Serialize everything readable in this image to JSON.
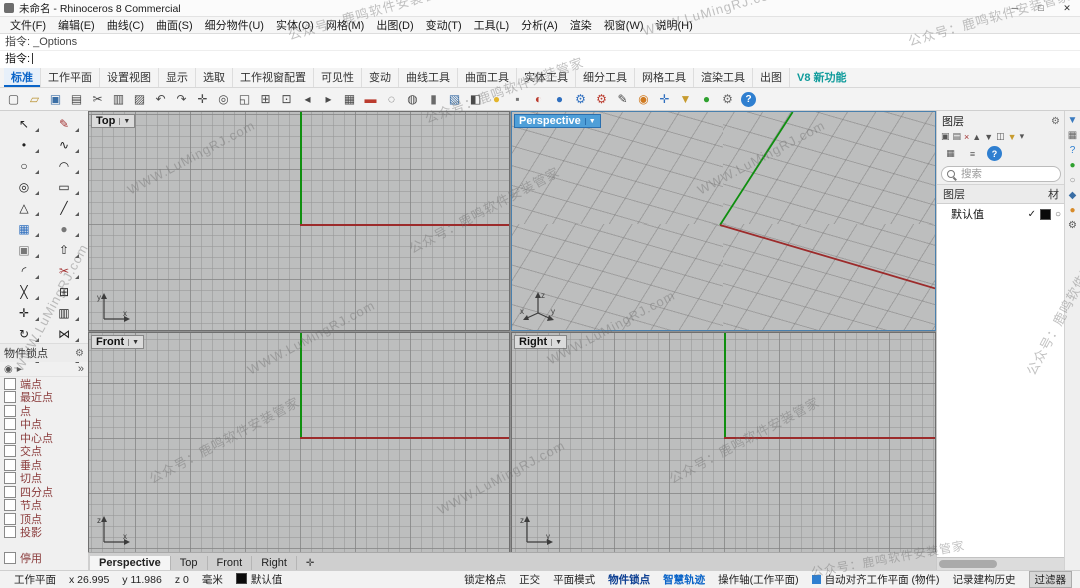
{
  "titlebar": {
    "title": "未命名 - Rhinoceros 8 Commercial",
    "minimize": "─",
    "maximize": "□",
    "close": "✕"
  },
  "menu": {
    "items": [
      "文件(F)",
      "编辑(E)",
      "曲线(C)",
      "曲面(S)",
      "细分物件(U)",
      "实体(O)",
      "网格(M)",
      "出图(D)",
      "变动(T)",
      "工具(L)",
      "分析(A)",
      "渲染",
      "视窗(W)",
      "说明(H)"
    ]
  },
  "command": {
    "history": "指令: _Options",
    "prompt": "指令:"
  },
  "ribbon": {
    "tabs": [
      {
        "label": "标准",
        "cls": "active"
      },
      {
        "label": "工作平面"
      },
      {
        "label": "设置视图"
      },
      {
        "label": "显示"
      },
      {
        "label": "选取"
      },
      {
        "label": "工作视窗配置"
      },
      {
        "label": "可见性"
      },
      {
        "label": "变动"
      },
      {
        "label": "曲线工具"
      },
      {
        "label": "曲面工具"
      },
      {
        "label": "实体工具"
      },
      {
        "label": "细分工具"
      },
      {
        "label": "网格工具"
      },
      {
        "label": "渲染工具"
      },
      {
        "label": "出图"
      },
      {
        "label": "V8 新功能",
        "cls": "teal"
      }
    ]
  },
  "toolbar": {
    "icons": [
      {
        "name": "new-file-icon",
        "glyph": "▢",
        "color": "#4a4a4a"
      },
      {
        "name": "open-file-icon",
        "glyph": "▱",
        "color": "#b8912f"
      },
      {
        "name": "save-file-icon",
        "glyph": "▣",
        "color": "#3a6ea5"
      },
      {
        "name": "print-icon",
        "glyph": "▤",
        "color": "#4a4a4a"
      },
      {
        "name": "cut-icon",
        "glyph": "✂",
        "color": "#4a4a4a"
      },
      {
        "name": "copy-icon",
        "glyph": "▥",
        "color": "#4a4a4a"
      },
      {
        "name": "paste-icon",
        "glyph": "▨",
        "color": "#4a4a4a"
      },
      {
        "name": "undo-icon",
        "glyph": "↶",
        "color": "#4a4a4a"
      },
      {
        "name": "redo-icon",
        "glyph": "↷",
        "color": "#4a4a4a"
      },
      {
        "name": "pan-icon",
        "glyph": "✛",
        "color": "#4a4a4a"
      },
      {
        "name": "zoom-dynamic-icon",
        "glyph": "◎",
        "color": "#4a4a4a"
      },
      {
        "name": "zoom-window-icon",
        "glyph": "◱",
        "color": "#4a4a4a"
      },
      {
        "name": "zoom-extents-icon",
        "glyph": "⊞",
        "color": "#4a4a4a"
      },
      {
        "name": "zoom-selected-icon",
        "glyph": "⊡",
        "color": "#4a4a4a"
      },
      {
        "name": "view-back-icon",
        "glyph": "◂",
        "color": "#4a4a4a"
      },
      {
        "name": "view-forward-icon",
        "glyph": "▸",
        "color": "#4a4a4a"
      },
      {
        "name": "named-view-icon",
        "glyph": "▦",
        "color": "#4a4a4a"
      },
      {
        "name": "car-icon",
        "glyph": "▬",
        "color": "#bb3b2e"
      },
      {
        "name": "hide-objects-icon",
        "glyph": "◌",
        "color": "#4a4a4a"
      },
      {
        "name": "show-objects-icon",
        "glyph": "◍",
        "color": "#4a4a4a"
      },
      {
        "name": "lock-objects-icon",
        "glyph": "▮",
        "color": "#6a6a6a"
      },
      {
        "name": "layer-dialog-icon",
        "glyph": "▧",
        "color": "#3a6ea5"
      },
      {
        "name": "object-properties-icon",
        "glyph": "◧",
        "color": "#4a4a4a"
      },
      {
        "name": "bulb-icon",
        "glyph": "●",
        "color": "#e3b52c"
      },
      {
        "name": "padlock-icon",
        "glyph": "▪",
        "color": "#777777"
      },
      {
        "name": "stoplight-icon",
        "glyph": "◐",
        "color": "#bb3b2e"
      },
      {
        "name": "sphere-blue-icon",
        "glyph": "●",
        "color": "#2f6fbf"
      },
      {
        "name": "gear-blue-icon",
        "glyph": "⚙",
        "color": "#2f6fbf"
      },
      {
        "name": "gear-red-icon",
        "glyph": "⚙",
        "color": "#bb3b2e"
      },
      {
        "name": "pencil-icon",
        "glyph": "✎",
        "color": "#4a4a4a"
      },
      {
        "name": "gumball-icon",
        "glyph": "◉",
        "color": "#d07a20"
      },
      {
        "name": "snap-icon",
        "glyph": "✛",
        "color": "#2f6fbf"
      },
      {
        "name": "filter-funnel-icon",
        "glyph": "▼",
        "color": "#c79b2e"
      },
      {
        "name": "globe-icon",
        "glyph": "●",
        "color": "#2fa12f"
      },
      {
        "name": "gears-icon",
        "glyph": "⚙",
        "color": "#6a6a6a"
      },
      {
        "name": "help-icon",
        "glyph": "?",
        "color": "#ffffff",
        "cls": "round-blue"
      }
    ]
  },
  "palette": {
    "icons": [
      {
        "name": "select-icon",
        "glyph": "↖",
        "color": "#222222"
      },
      {
        "name": "lasso-select-icon",
        "glyph": "✎",
        "color": "#a33333"
      },
      {
        "name": "point-icon",
        "glyph": "•",
        "color": "#222222"
      },
      {
        "name": "curve-icon",
        "glyph": "∿",
        "color": "#222222"
      },
      {
        "name": "circle-icon",
        "glyph": "○",
        "color": "#222222"
      },
      {
        "name": "arc-icon",
        "glyph": "◠",
        "color": "#222222"
      },
      {
        "name": "ellipse-icon",
        "glyph": "◎",
        "color": "#222222"
      },
      {
        "name": "rectangle-icon",
        "glyph": "▭",
        "color": "#222222"
      },
      {
        "name": "polygon-icon",
        "glyph": "△",
        "color": "#222222"
      },
      {
        "name": "polyline-icon",
        "glyph": "╱",
        "color": "#222222"
      },
      {
        "name": "surface-icon",
        "glyph": "▦",
        "color": "#2f6fbf"
      },
      {
        "name": "sphere-icon",
        "glyph": "●",
        "color": "#777777"
      },
      {
        "name": "box-icon",
        "glyph": "▣",
        "color": "#777777"
      },
      {
        "name": "extrude-icon",
        "glyph": "⇧",
        "color": "#222222"
      },
      {
        "name": "fillet-icon",
        "glyph": "◜",
        "color": "#222222"
      },
      {
        "name": "trim-icon",
        "glyph": "✂",
        "color": "#a33333"
      },
      {
        "name": "split-icon",
        "glyph": "╳",
        "color": "#222222"
      },
      {
        "name": "join-icon",
        "glyph": "⊞",
        "color": "#222222"
      },
      {
        "name": "move-icon",
        "glyph": "✛",
        "color": "#222222"
      },
      {
        "name": "copy-object-icon",
        "glyph": "▥",
        "color": "#222222"
      },
      {
        "name": "rotate-icon",
        "glyph": "↻",
        "color": "#222222"
      },
      {
        "name": "mirror-icon",
        "glyph": "⋈",
        "color": "#222222"
      },
      {
        "name": "scale-icon",
        "glyph": "◿",
        "color": "#222222"
      },
      {
        "name": "array-icon",
        "glyph": "▩",
        "color": "#222222"
      }
    ]
  },
  "osnap": {
    "title": "物件锁点",
    "items": [
      "端点",
      "最近点",
      "点",
      "中点",
      "中心点",
      "交点",
      "垂点",
      "切点",
      "四分点",
      "节点",
      "顶点",
      "投影"
    ],
    "disable_label": "停用"
  },
  "viewports": {
    "top": {
      "title": "Top",
      "axis": [
        "y",
        "x"
      ]
    },
    "perspective": {
      "title": "Perspective",
      "axis": [
        "z",
        "x",
        "y"
      ]
    },
    "front": {
      "title": "Front",
      "axis": [
        "z",
        "x"
      ]
    },
    "right": {
      "title": "Right",
      "axis": [
        "z",
        "y"
      ]
    }
  },
  "viewport_tabs": {
    "items": [
      {
        "label": "Perspective",
        "cls": "active",
        "name": "viewport-tab-perspective"
      },
      {
        "label": "Top",
        "name": "viewport-tab-top"
      },
      {
        "label": "Front",
        "name": "viewport-tab-front"
      },
      {
        "label": "Right",
        "name": "viewport-tab-right"
      },
      {
        "label": "✛",
        "cls": "vpt-icon",
        "name": "new-viewport-tab-icon"
      }
    ]
  },
  "layers_panel": {
    "title": "图层",
    "search_placeholder": "搜索",
    "columns": {
      "layer": "图层",
      "material": "材"
    },
    "tool_icons": [
      {
        "name": "new-layer-icon",
        "glyph": "▣",
        "color": "#555555"
      },
      {
        "name": "new-sublayer-icon",
        "glyph": "▤",
        "color": "#555555"
      },
      {
        "name": "delete-layer-icon",
        "glyph": "×",
        "color": "#a33333"
      },
      {
        "name": "move-up-icon",
        "glyph": "▲",
        "color": "#555555"
      },
      {
        "name": "move-down-icon",
        "glyph": "▼",
        "color": "#555555"
      },
      {
        "name": "expand-layers-icon",
        "glyph": "◫",
        "color": "#555555"
      },
      {
        "name": "filter-funnel-icon",
        "glyph": "▼",
        "color": "#c79b2e"
      },
      {
        "name": "layer-menu-icon",
        "glyph": "▾",
        "color": "#555555"
      }
    ],
    "view_icons": [
      {
        "name": "columns-icon",
        "glyph": "▦",
        "color": "#555555"
      },
      {
        "name": "list-menu-icon",
        "glyph": "≡",
        "color": "#555555"
      },
      {
        "name": "help-icon",
        "glyph": "?",
        "color": "#ffffff",
        "cls": "round-blue"
      }
    ],
    "rows": [
      {
        "name": "默认值",
        "current": "✓",
        "color": "#0a0a0a",
        "material_icon": "○"
      }
    ]
  },
  "side_strip": {
    "icons": [
      {
        "name": "panel-tab-filter-icon",
        "glyph": "▼",
        "color": "#3a7abf"
      },
      {
        "name": "panel-tab-grid-icon",
        "glyph": "▦",
        "color": "#666666"
      },
      {
        "name": "panel-tab-help-icon",
        "glyph": "?",
        "color": "#2f7fd0"
      },
      {
        "name": "panel-tab-display-icon",
        "glyph": "●",
        "color": "#2fa12f"
      },
      {
        "name": "panel-tab-circle-icon",
        "glyph": "○",
        "color": "#888888"
      },
      {
        "name": "panel-tab-material-icon",
        "glyph": "◆",
        "color": "#3a6ea5"
      },
      {
        "name": "panel-tab-sun-icon",
        "glyph": "●",
        "color": "#d78b2a"
      },
      {
        "name": "panel-tab-gear-icon",
        "glyph": "⚙",
        "color": "#555555"
      }
    ]
  },
  "statusbar": {
    "items": [
      {
        "name": "statusbar-cplane",
        "label": "工作平面"
      },
      {
        "name": "statusbar-x",
        "label": "x 26.995"
      },
      {
        "name": "statusbar-y",
        "label": "y 11.986"
      },
      {
        "name": "statusbar-z",
        "label": "z 0"
      },
      {
        "name": "statusbar-units",
        "label": "毫米"
      },
      {
        "name": "statusbar-layer",
        "label": "默认值",
        "cls": "sb-swatch"
      },
      {
        "name": "statusbar-spacer",
        "label": "",
        "cls": "sb-flex"
      },
      {
        "name": "statusbar-gridsnap",
        "label": "锁定格点"
      },
      {
        "name": "statusbar-ortho",
        "label": "正交"
      },
      {
        "name": "statusbar-planar",
        "label": "平面模式"
      },
      {
        "name": "statusbar-osnap",
        "label": "物件锁点",
        "cls": "sb-strong"
      },
      {
        "name": "statusbar-smarttrack",
        "label": "智慧轨迹",
        "cls": "sb-active"
      },
      {
        "name": "statusbar-gumball",
        "label": "操作轴(工作平面)"
      },
      {
        "name": "statusbar-autocplane",
        "label": "自动对齐工作平面 (物件)",
        "cls": "sb-align"
      },
      {
        "name": "statusbar-history",
        "label": "记录建构历史"
      },
      {
        "name": "statusbar-filter",
        "label": "过滤器",
        "cls": "sb-pressed"
      }
    ]
  },
  "icons": {
    "gear": "⚙",
    "dropdown": "▼",
    "target": "◉",
    "play": "▸",
    "chevrons": "»"
  },
  "watermarks": {
    "channel": "公众号：鹿鸣软件安装管家",
    "brand": "WWW.LuMingRJ.com"
  }
}
